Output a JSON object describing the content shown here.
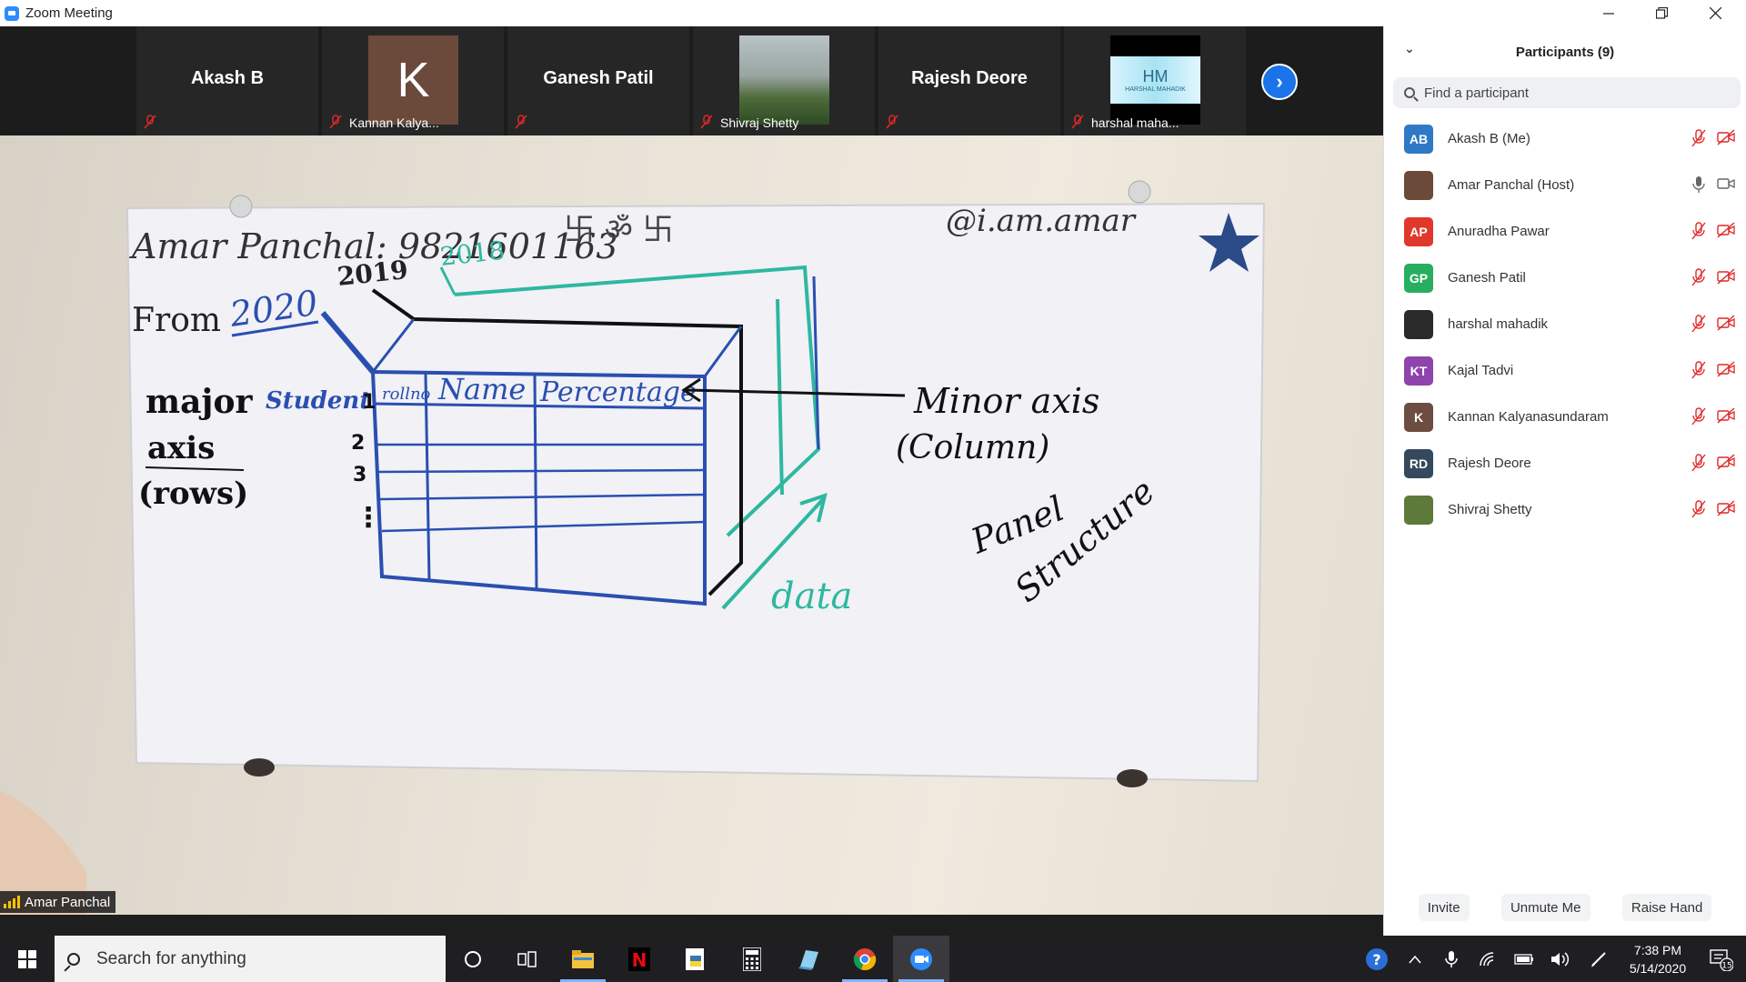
{
  "window": {
    "title": "Zoom Meeting"
  },
  "thumbnails": [
    {
      "name": "Akash B",
      "label": ""
    },
    {
      "name": "",
      "initial": "K",
      "label": "Kannan Kalya..."
    },
    {
      "name": "Ganesh Patil",
      "label": ""
    },
    {
      "name": "",
      "label": "Shivraj Shetty"
    },
    {
      "name": "Rajesh Deore",
      "label": ""
    },
    {
      "name": "",
      "logo_text": "HM",
      "logo_sub": "HARSHAL MAHADIK",
      "label": "harshal maha..."
    }
  ],
  "speaker": {
    "name": "Amar Panchal"
  },
  "whiteboard": {
    "header": "Amar Panchal: 9821601163",
    "handle": "@i.am.amar",
    "symbols": "卐 ॐ 卐",
    "year_2019": "2019",
    "year_2018": "2018",
    "from_label": "From",
    "year_2020": "2020",
    "major_axis": [
      "major",
      "axis",
      "(rows)"
    ],
    "student": "Student",
    "row_numbers": [
      "1",
      "2",
      "3",
      "⋮"
    ],
    "col_headers": [
      "rollno",
      "Name",
      "Percentage"
    ],
    "minor_axis": [
      "Minor axis",
      "(Column)"
    ],
    "panel_structure": [
      "Panel",
      "Structure"
    ],
    "data_label": "data"
  },
  "panel": {
    "title": "Participants (9)",
    "search_placeholder": "Find a participant",
    "participants": [
      {
        "initials": "AB",
        "name": "Akash B (Me)",
        "color": "#2f79c6",
        "muted": true
      },
      {
        "initials": "",
        "name": "Amar Panchal (Host)",
        "color": "#6b4a3a",
        "muted": false
      },
      {
        "initials": "AP",
        "name": "Anuradha Pawar",
        "color": "#e0392b",
        "muted": true
      },
      {
        "initials": "GP",
        "name": "Ganesh Patil",
        "color": "#27ae60",
        "muted": true
      },
      {
        "initials": "",
        "name": "harshal mahadik",
        "color": "#2a2a2a",
        "muted": true
      },
      {
        "initials": "KT",
        "name": "Kajal Tadvi",
        "color": "#8e44ad",
        "muted": true
      },
      {
        "initials": "K",
        "name": "Kannan Kalyanasundaram",
        "color": "#6d4c41",
        "muted": true
      },
      {
        "initials": "RD",
        "name": "Rajesh Deore",
        "color": "#34495e",
        "muted": true
      },
      {
        "initials": "",
        "name": "Shivraj Shetty",
        "color": "#5d7a3a",
        "muted": true
      }
    ],
    "footer": {
      "invite": "Invite",
      "unmute": "Unmute Me",
      "raise_hand": "Raise Hand"
    }
  },
  "taskbar": {
    "search_placeholder": "Search for anything",
    "time": "7:38 PM",
    "date": "5/14/2020",
    "notifications": "15"
  }
}
